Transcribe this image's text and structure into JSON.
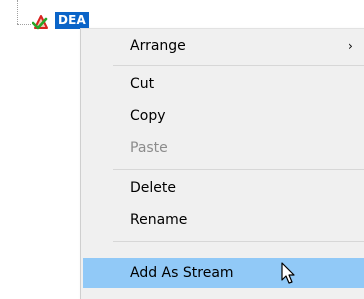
{
  "tree": {
    "node_label": "DEA",
    "node_icon": "checkmark-triangle-icon"
  },
  "menu": {
    "items": [
      {
        "label": "Arrange",
        "submenu_arrow": "›",
        "enabled": true,
        "highlighted": false
      },
      {
        "label": "Cut",
        "enabled": true,
        "highlighted": false
      },
      {
        "label": "Copy",
        "enabled": true,
        "highlighted": false
      },
      {
        "label": "Paste",
        "enabled": false,
        "highlighted": false
      },
      {
        "label": "Delete",
        "enabled": true,
        "highlighted": false
      },
      {
        "label": "Rename",
        "enabled": true,
        "highlighted": false
      },
      {
        "label": "Add As Stream",
        "enabled": true,
        "highlighted": true
      }
    ]
  },
  "colors": {
    "selection": "#0a64c8",
    "highlight": "#91c9f7",
    "menu_background": "#f0f0f0",
    "disabled_text": "#8c8c8c"
  },
  "cursor_icon": "mouse-pointer-icon"
}
